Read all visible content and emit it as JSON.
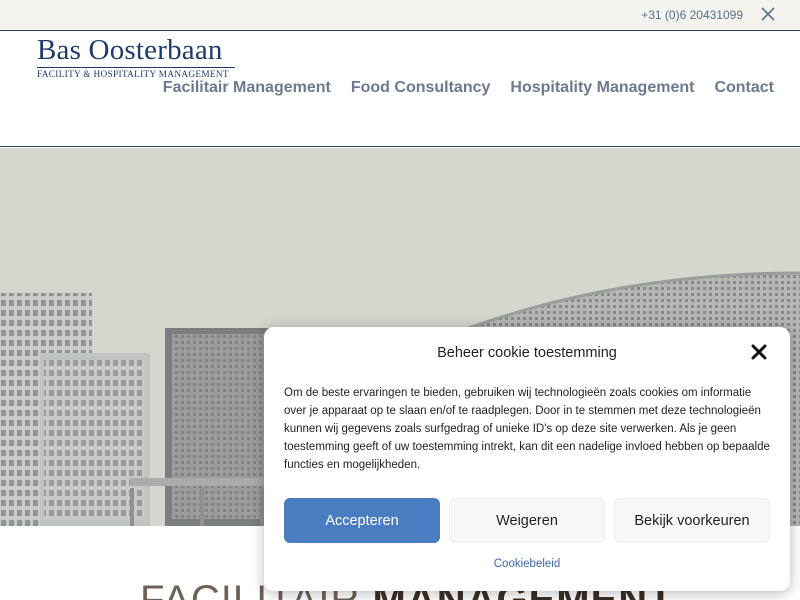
{
  "topbar": {
    "phone": "+31 (0)6 20431099",
    "social_icon": "x-twitter-icon"
  },
  "logo": {
    "name": "Bas Oosterbaan",
    "subtitle": "FACILITY & HOSPITALITY MANAGEMENT"
  },
  "nav": {
    "items": [
      {
        "label": "Facilitair Management"
      },
      {
        "label": "Food Consultancy"
      },
      {
        "label": "Hospitality Management"
      },
      {
        "label": "Contact"
      }
    ]
  },
  "hero": {
    "image": "city skyline with modern office buildings"
  },
  "section": {
    "heading_light": "FACILITAIR ",
    "heading_bold": "MANAGEMENT"
  },
  "cookie": {
    "title": "Beheer cookie toestemming",
    "body": "Om de beste ervaringen te bieden, gebruiken wij technologieën zoals cookies om informatie over je apparaat op te slaan en/of te raadplegen. Door in te stemmen met deze technologieën kunnen wij gegevens zoals surfgedrag of unieke ID's op deze site verwerken. Als je geen toestemming geeft of uw toestemming intrekt, kan dit een nadelige invloed hebben op bepaalde functies en mogelijkheden.",
    "accept_label": "Accepteren",
    "deny_label": "Weigeren",
    "prefs_label": "Bekijk voorkeuren",
    "policy_link": "Cookiebeleid"
  },
  "colors": {
    "brand": "#1f3a6b",
    "accent": "#4a7cc2",
    "nav": "#6b7a8f"
  }
}
